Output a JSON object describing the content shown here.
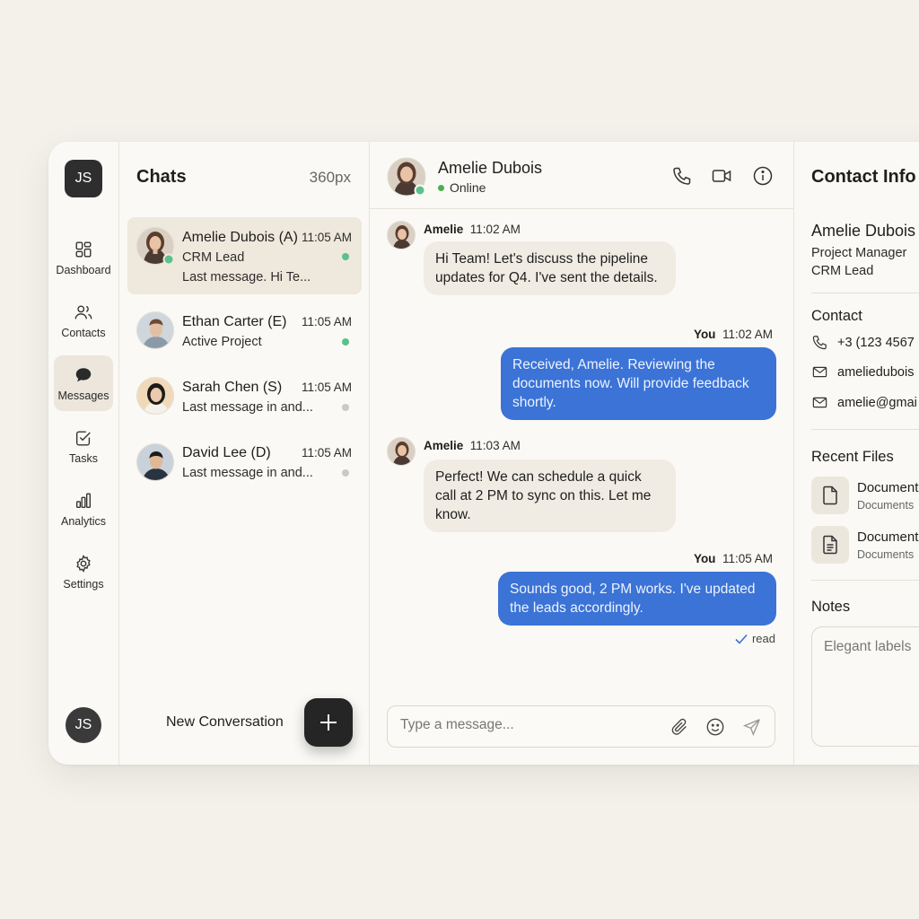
{
  "rail": {
    "logo": "JS",
    "items": [
      {
        "label": "Dashboard",
        "icon": "dashboard-icon"
      },
      {
        "label": "Contacts",
        "icon": "contacts-icon"
      },
      {
        "label": "Messages",
        "icon": "messages-icon",
        "active": true
      },
      {
        "label": "Tasks",
        "icon": "tasks-icon"
      },
      {
        "label": "Analytics",
        "icon": "analytics-icon"
      },
      {
        "label": "Settings",
        "icon": "settings-icon"
      }
    ],
    "user_initials": "JS"
  },
  "chats": {
    "title": "Chats",
    "size_label": "360px",
    "items": [
      {
        "name": "Amelie Dubois (A)",
        "time": "11:05 AM",
        "line1": "CRM Lead",
        "line2": "Last message. Hi Te...",
        "dot": "#5cc08a",
        "active": true
      },
      {
        "name": "Ethan Carter (E)",
        "time": "11:05 AM",
        "line1": "Active Project",
        "dot": "#5cc08a"
      },
      {
        "name": "Sarah Chen (S)",
        "time": "11:05 AM",
        "line1": "Last message in and...",
        "dot": "#c9c9c9"
      },
      {
        "name": "David Lee (D)",
        "time": "11:05 AM",
        "line1": "Last message in and...",
        "dot": "#c9c9c9"
      }
    ],
    "new_conversation": "New Conversation"
  },
  "conversation": {
    "name": "Amelie Dubois",
    "status": "Online",
    "messages": [
      {
        "from": "Amelie",
        "time": "11:02 AM",
        "text": "Hi Team! Let's discuss the pipeline updates for Q4. I've sent the details."
      },
      {
        "from": "You",
        "time": "11:02 AM",
        "text": "Received, Amelie. Reviewing the documents now. Will provide feedback shortly."
      },
      {
        "from": "Amelie",
        "time": "11:03 AM",
        "text": "Perfect! We can schedule a quick call at 2 PM to sync on this. Let me know."
      },
      {
        "from": "You",
        "time": "11:05 AM",
        "text": "Sounds good, 2 PM works. I've updated the leads accordingly."
      }
    ],
    "read_label": "read",
    "composer_placeholder": "Type a message..."
  },
  "contact_info": {
    "title": "Contact Info",
    "name": "Amelie Dubois",
    "role": "Project Manager",
    "tag": "CRM Lead",
    "contact_heading": "Contact",
    "phone": "+3 (123 4567",
    "email1": "ameliedubois",
    "email2": "amelie@gmai",
    "files_heading": "Recent Files",
    "files": [
      {
        "name": "Document",
        "sub": "Documents"
      },
      {
        "name": "Document",
        "sub": "Documents"
      }
    ],
    "notes_heading": "Notes",
    "notes_text": "Elegant labels"
  },
  "colors": {
    "accent_blue": "#3b73d6",
    "online_green": "#5cc08a",
    "background": "#f4f1ea"
  }
}
